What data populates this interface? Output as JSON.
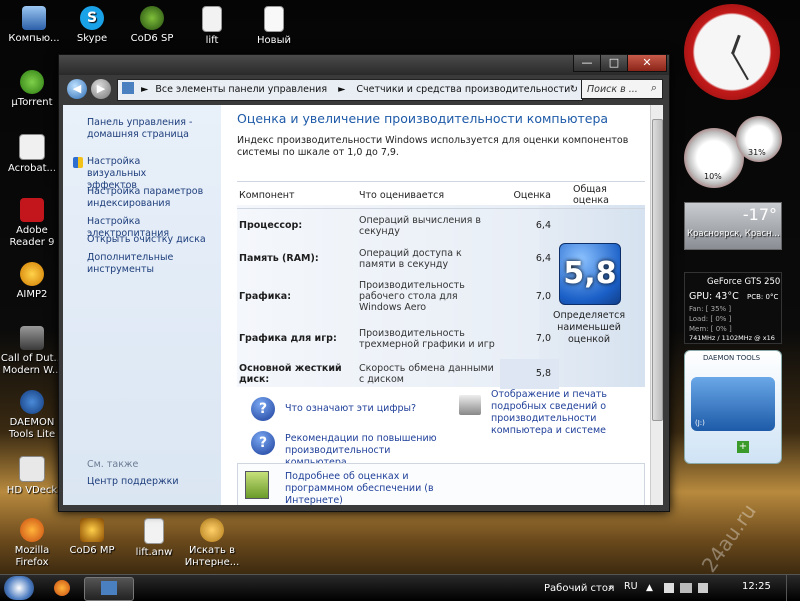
{
  "desktop": {
    "icons": [
      {
        "label": "Компью..."
      },
      {
        "label": "Skype"
      },
      {
        "label": "CoD6 SP"
      },
      {
        "label": "lift"
      },
      {
        "label": "Новый"
      },
      {
        "label": "µTorrent"
      },
      {
        "label": "Acrobat..."
      },
      {
        "label": "Adobe"
      },
      {
        "label": "Reader 9"
      },
      {
        "label": "AIMP2"
      },
      {
        "label": "Call of Dut..."
      },
      {
        "label": "Modern W..."
      },
      {
        "label": "DAEMON"
      },
      {
        "label": "Tools Lite"
      },
      {
        "label": "HD VDeck"
      },
      {
        "label": "Mozilla"
      },
      {
        "label": "Firefox"
      },
      {
        "label": "CoD6 MP"
      },
      {
        "label": "lift.anw"
      },
      {
        "label": "Искать в"
      },
      {
        "label": "Интерне..."
      }
    ]
  },
  "window": {
    "breadcrumb": {
      "part1": "Все элементы панели управления",
      "sep": "►",
      "part2": "Счетчики и средства производительности"
    },
    "search_placeholder": "Поиск в ...",
    "buttons": {
      "minimize": "—",
      "maximize": "□",
      "close": "✕"
    }
  },
  "sidebar": {
    "links": [
      "Панель управления - домашняя страница",
      "Настройка визуальных эффектов",
      "Настройка параметров индексирования",
      "Настройка электропитания",
      "Открыть очистку диска",
      "Дополнительные инструменты"
    ],
    "see_also": "См. также",
    "support": "Центр поддержки"
  },
  "main": {
    "title": "Оценка и увеличение производительности компьютера",
    "intro": "Индекс производительности Windows используется для оценки компонентов системы по шкале от 1,0 до 7,9.",
    "columns": [
      "Компонент",
      "Что оценивается",
      "Оценка",
      "Общая оценка"
    ],
    "rows": [
      {
        "component": "Процессор:",
        "desc": "Операций вычисления в секунду",
        "score": "6,4"
      },
      {
        "component": "Память (RAM):",
        "desc": "Операций доступа к памяти в секунду",
        "score": "6,4"
      },
      {
        "component": "Графика:",
        "desc": "Производительность рабочего стола для Windows Aero",
        "score": "7,0"
      },
      {
        "component": "Графика для игр:",
        "desc": "Производительность трехмерной графики и игр",
        "score": "7,0"
      },
      {
        "component": "Основной жесткий диск:",
        "desc": "Скорость обмена данными с диском",
        "score": "5,8"
      }
    ],
    "base_score": "5,8",
    "base_caption": "Определяется наименьшей оценкой",
    "links": {
      "meaning": "Что означают эти цифры?",
      "print": "Отображение и печать подробных сведений о производительности компьютера и системе",
      "recommend": "Рекомендации по повышению производительности компьютера.",
      "more": "Подробнее об оценках и программном обеспечении (в Интернете)"
    }
  },
  "gadgets": {
    "cpu_percent": "10%",
    "mem_percent": "31%",
    "weather_temp": "-17°",
    "weather_city": "Красноярск, Красн...",
    "gpu_title": "GeForce GTS 250",
    "gpu_temp": "GPU: 43°C",
    "gpu_pcb": "PCB: 0°C",
    "gpu_fan": "Fan: [ 35% ]",
    "gpu_load": "Load: [ 0% ]",
    "gpu_mem": "Mem: [ 0% ]",
    "gpu_clocks": "741MHz / 1102MHz @ x16",
    "daemon_title": "DAEMON TOOLS",
    "daemon_drive": "(J:)"
  },
  "taskbar": {
    "desktop_label": "Рабочий стол",
    "lang": "RU",
    "time": "12:25"
  },
  "watermark": "24au.ru"
}
